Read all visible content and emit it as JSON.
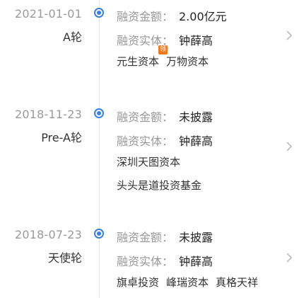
{
  "rounds": [
    {
      "date": "2021-01-01",
      "name": "A轮",
      "amount_label": "融资金额：",
      "amount": "2.00亿元",
      "entity_label": "融资实体：",
      "entity": "钟薛高",
      "investors": [
        "元生资本",
        "万物资本"
      ],
      "lead_badge": "领"
    },
    {
      "date": "2018-11-23",
      "name": "Pre-A轮",
      "amount_label": "融资金额：",
      "amount": "未披露",
      "entity_label": "融资实体：",
      "entity": "钟薛高",
      "investors": [
        "深圳天图资本",
        "头头是道投资基金"
      ]
    },
    {
      "date": "2018-07-23",
      "name": "天使轮",
      "amount_label": "融资金额：",
      "amount": "未披露",
      "entity_label": "融资实体：",
      "entity": "钟薛高",
      "investors": [
        "旗卓投资",
        "峰瑞资本",
        "真格天祥"
      ]
    }
  ],
  "colors": {
    "accent": "#3a7ee8",
    "badge": "#f07a1a",
    "muted": "#999999",
    "text": "#222222"
  }
}
